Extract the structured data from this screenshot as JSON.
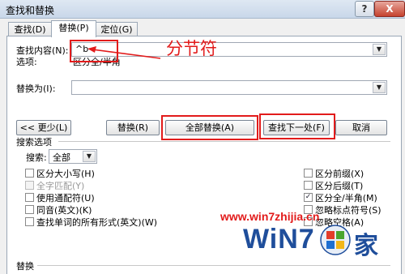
{
  "window": {
    "title": "查找和替换",
    "help_label": "?",
    "close_label": "X"
  },
  "tabs": [
    {
      "label": "查找(D)"
    },
    {
      "label": "替换(P)"
    },
    {
      "label": "定位(G)"
    }
  ],
  "find": {
    "label": "查找内容(N):",
    "value": "^b",
    "options_label": "选项:",
    "options_value": "区分全/半角"
  },
  "replace": {
    "label": "替换为(I):",
    "value": ""
  },
  "buttons": {
    "less": "<< 更少(L)",
    "replace": "替换(R)",
    "replace_all": "全部替换(A)",
    "find_next": "查找下一处(F)",
    "cancel": "取消"
  },
  "search_options": {
    "title": "搜索选项",
    "search_label": "搜索:",
    "search_value": "全部",
    "left": [
      {
        "label": "区分大小写(H)",
        "checked": false,
        "disabled": false
      },
      {
        "label": "全字匹配(Y)",
        "checked": false,
        "disabled": true
      },
      {
        "label": "使用通配符(U)",
        "checked": false,
        "disabled": false
      },
      {
        "label": "同音(英文)(K)",
        "checked": false,
        "disabled": false
      },
      {
        "label": "查找单词的所有形式(英文)(W)",
        "checked": false,
        "disabled": false
      }
    ],
    "right": [
      {
        "label": "区分前缀(X)",
        "checked": false,
        "disabled": false
      },
      {
        "label": "区分后缀(T)",
        "checked": false,
        "disabled": false
      },
      {
        "label": "区分全/半角(M)",
        "checked": true,
        "disabled": false
      },
      {
        "label": "忽略标点符号(S)",
        "checked": false,
        "disabled": false
      },
      {
        "label": "忽略空格(A)",
        "checked": false,
        "disabled": false
      }
    ]
  },
  "replace_section": {
    "title": "替换"
  },
  "annotation": {
    "text": "分节符",
    "color": "#e21b1b"
  },
  "watermark": {
    "url": "www.win7zhijia.cn",
    "logo": "WiN7",
    "logo_suffix": "家"
  }
}
